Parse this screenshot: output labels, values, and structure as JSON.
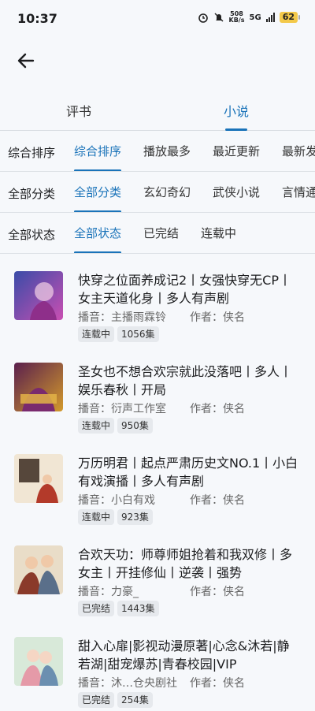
{
  "status": {
    "time": "10:37",
    "net_speed": "508",
    "net_unit": "KB/s",
    "network": "5G",
    "battery": "62"
  },
  "tabs": [
    "评书",
    "小说"
  ],
  "filters": [
    {
      "label": "综合排序",
      "options": [
        "综合排序",
        "播放最多",
        "最近更新",
        "最新发布"
      ],
      "active": 0
    },
    {
      "label": "全部分类",
      "options": [
        "全部分类",
        "玄幻奇幻",
        "武侠小说",
        "言情通俗"
      ],
      "active": 0
    },
    {
      "label": "全部状态",
      "options": [
        "全部状态",
        "已完结",
        "连载中"
      ],
      "active": 0
    }
  ],
  "books": [
    {
      "title": "快穿之位面养成记2丨女强快穿无CP丨女主天道化身丨多人有声剧",
      "narrator": "播音：主播雨霖铃",
      "author": "作者：侠名",
      "status": "连载中",
      "episodes": "1056集",
      "cover_colors": [
        "#3a4ca8",
        "#c94fb2"
      ]
    },
    {
      "title": "圣女也不想合欢宗就此没落吧丨多人丨娱乐春秋丨开局",
      "narrator": "播音：衍声工作室",
      "author": "作者：侠名",
      "status": "连载中",
      "episodes": "950集",
      "cover_colors": [
        "#5a1f4d",
        "#d39a2c"
      ]
    },
    {
      "title": "万历明君丨起点严肃历史文NO.1丨小白有戏演播丨多人有声剧",
      "narrator": "播音：小白有戏",
      "author": "作者：侠名",
      "status": "连载中",
      "episodes": "923集",
      "cover_colors": [
        "#f1e6d4",
        "#b33a2a"
      ]
    },
    {
      "title": "合欢天功：师尊师姐抢着和我双修丨多女主丨开挂修仙丨逆袭丨强势",
      "narrator": "播音：力豪_",
      "author": "作者：侠名",
      "status": "已完结",
      "episodes": "1443集",
      "cover_colors": [
        "#e9ddc8",
        "#8a3a2a"
      ]
    },
    {
      "title": "甜入心扉|影视动漫原著|心念&沐若|静若湖|甜宠爆苏|青春校园|VIP",
      "narrator": "播音：沐…仓央剧社",
      "author": "作者：侠名",
      "status": "已完结",
      "episodes": "254集",
      "cover_colors": [
        "#d8e9d9",
        "#e59aa8"
      ]
    }
  ]
}
